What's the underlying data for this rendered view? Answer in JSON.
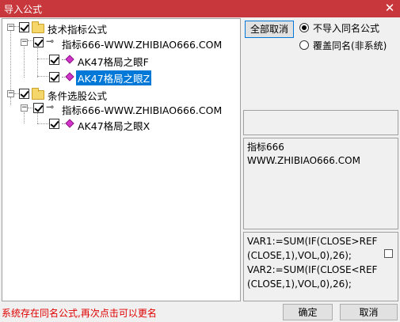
{
  "window": {
    "title": "导入公式",
    "close_glyph": "✕"
  },
  "tree": {
    "nodes": [
      {
        "label": "技术指标公式"
      },
      {
        "label": "指标666-WWW.ZHIBIAO666.COM"
      },
      {
        "label": "AK47格局之眼F"
      },
      {
        "label": "AK47格局之眼Z"
      },
      {
        "label": "条件选股公式"
      },
      {
        "label": "指标666-WWW.ZHIBIAO666.COM"
      },
      {
        "label": "AK47格局之眼X"
      }
    ]
  },
  "options": {
    "deselect_all": "全部取消",
    "no_import_same_name": "不导入同名公式",
    "overwrite_same_name": "覆盖同名(非系统)"
  },
  "info": {
    "line1": "指标666",
    "line2": "WWW.ZHIBIAO666.COM"
  },
  "code": {
    "line1": "VAR1:=SUM(IF(CLOSE>REF",
    "line2": "(CLOSE,1),VOL,0),26);",
    "line3": "VAR2:=SUM(IF(CLOSE<REF",
    "line4": "(CLOSE,1),VOL,0),26);"
  },
  "footer": {
    "status": "系统存在同名公式,再次点击可以更名",
    "ok": "确定",
    "cancel": "取消"
  }
}
